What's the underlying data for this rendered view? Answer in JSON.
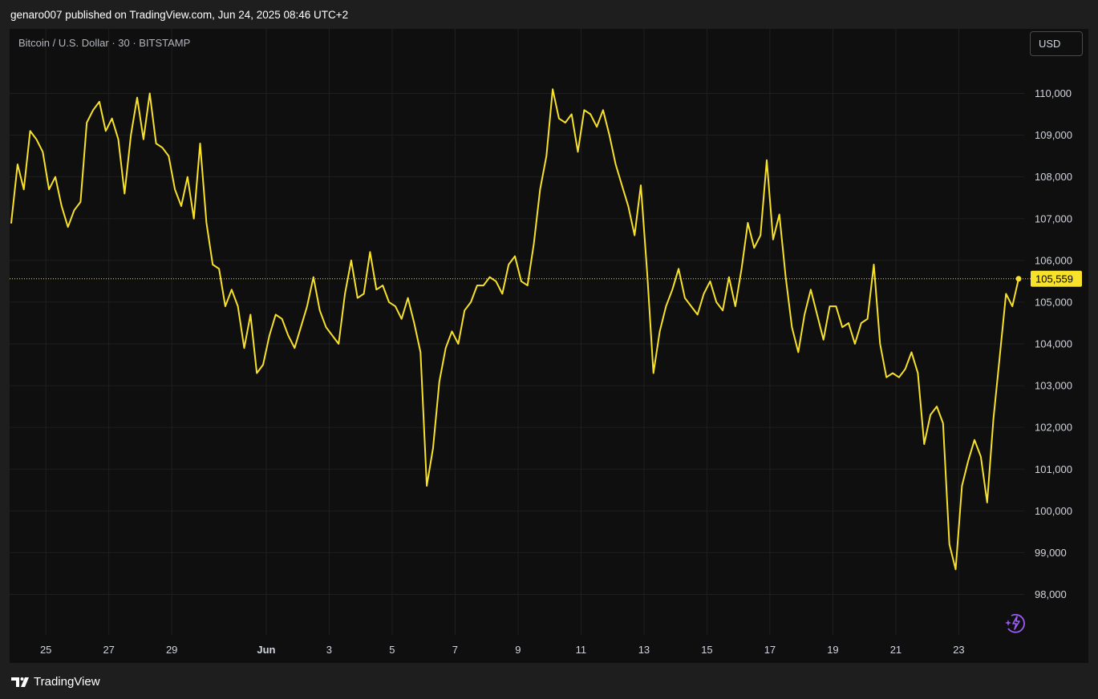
{
  "header": {
    "published_text": "genaro007 published on TradingView.com, Jun 24, 2025 08:46 UTC+2"
  },
  "chart_header": {
    "symbol_label": "Bitcoin / U.S. Dollar · 30 · BITSTAMP",
    "currency_button": "USD"
  },
  "footer": {
    "brand": "TradingView"
  },
  "icons": [
    "tradingview-logo-icon",
    "lightning-icon"
  ],
  "colors": {
    "line": "#f7e12a",
    "background": "#0f0f0f",
    "grid": "#1f1f1f",
    "price_label_bg": "#f7e12a",
    "bolt": "#9b5cf6"
  },
  "chart_data": {
    "type": "line",
    "title": "Bitcoin / U.S. Dollar · 30 · BITSTAMP",
    "xlabel": "",
    "ylabel": "",
    "ylim": [
      97200,
      111200
    ],
    "grid": true,
    "legend": "none",
    "y_ticks": [
      98000,
      99000,
      100000,
      101000,
      102000,
      103000,
      104000,
      105000,
      106000,
      107000,
      108000,
      109000,
      110000
    ],
    "y_tick_labels": [
      "98,000",
      "99,000",
      "100,000",
      "101,000",
      "102,000",
      "103,000",
      "104,000",
      "105,000",
      "106,000",
      "107,000",
      "108,000",
      "109,000",
      "110,000"
    ],
    "x_ticks": [
      {
        "label": "25",
        "t": 25
      },
      {
        "label": "27",
        "t": 27
      },
      {
        "label": "29",
        "t": 29
      },
      {
        "label": "Jun",
        "t": 32
      },
      {
        "label": "3",
        "t": 34
      },
      {
        "label": "5",
        "t": 36
      },
      {
        "label": "7",
        "t": 38
      },
      {
        "label": "9",
        "t": 40
      },
      {
        "label": "11",
        "t": 42
      },
      {
        "label": "13",
        "t": 44
      },
      {
        "label": "15",
        "t": 46
      },
      {
        "label": "17",
        "t": 48
      },
      {
        "label": "19",
        "t": 50
      },
      {
        "label": "21",
        "t": 52
      },
      {
        "label": "23",
        "t": 54
      }
    ],
    "last_price": 105559,
    "last_price_label": "105,559",
    "series": [
      {
        "points": [
          [
            23.9,
            106900
          ],
          [
            24.1,
            108300
          ],
          [
            24.3,
            107700
          ],
          [
            24.5,
            109100
          ],
          [
            24.7,
            108900
          ],
          [
            24.9,
            108600
          ],
          [
            25.1,
            107700
          ],
          [
            25.3,
            108000
          ],
          [
            25.5,
            107300
          ],
          [
            25.7,
            106800
          ],
          [
            25.9,
            107200
          ],
          [
            26.1,
            107400
          ],
          [
            26.3,
            109300
          ],
          [
            26.5,
            109600
          ],
          [
            26.7,
            109800
          ],
          [
            26.9,
            109100
          ],
          [
            27.1,
            109400
          ],
          [
            27.3,
            108900
          ],
          [
            27.5,
            107600
          ],
          [
            27.7,
            109000
          ],
          [
            27.9,
            109900
          ],
          [
            28.1,
            108900
          ],
          [
            28.3,
            110000
          ],
          [
            28.5,
            108800
          ],
          [
            28.7,
            108700
          ],
          [
            28.9,
            108500
          ],
          [
            29.1,
            107700
          ],
          [
            29.3,
            107300
          ],
          [
            29.5,
            108000
          ],
          [
            29.7,
            107000
          ],
          [
            29.9,
            108800
          ],
          [
            30.1,
            106900
          ],
          [
            30.3,
            105900
          ],
          [
            30.5,
            105800
          ],
          [
            30.7,
            104900
          ],
          [
            30.9,
            105300
          ],
          [
            31.1,
            104900
          ],
          [
            31.3,
            103900
          ],
          [
            31.5,
            104700
          ],
          [
            31.7,
            103300
          ],
          [
            31.9,
            103500
          ],
          [
            32.1,
            104200
          ],
          [
            32.3,
            104700
          ],
          [
            32.5,
            104600
          ],
          [
            32.7,
            104200
          ],
          [
            32.9,
            103900
          ],
          [
            33.1,
            104400
          ],
          [
            33.3,
            104900
          ],
          [
            33.5,
            105600
          ],
          [
            33.7,
            104800
          ],
          [
            33.9,
            104400
          ],
          [
            34.1,
            104200
          ],
          [
            34.3,
            104000
          ],
          [
            34.5,
            105200
          ],
          [
            34.7,
            106000
          ],
          [
            34.9,
            105100
          ],
          [
            35.1,
            105200
          ],
          [
            35.3,
            106200
          ],
          [
            35.5,
            105300
          ],
          [
            35.7,
            105400
          ],
          [
            35.9,
            105000
          ],
          [
            36.1,
            104900
          ],
          [
            36.3,
            104600
          ],
          [
            36.5,
            105100
          ],
          [
            36.7,
            104500
          ],
          [
            36.9,
            103800
          ],
          [
            37.1,
            100600
          ],
          [
            37.3,
            101500
          ],
          [
            37.5,
            103100
          ],
          [
            37.7,
            103900
          ],
          [
            37.9,
            104300
          ],
          [
            38.1,
            104000
          ],
          [
            38.3,
            104800
          ],
          [
            38.5,
            105000
          ],
          [
            38.7,
            105400
          ],
          [
            38.9,
            105400
          ],
          [
            39.1,
            105600
          ],
          [
            39.3,
            105500
          ],
          [
            39.5,
            105200
          ],
          [
            39.7,
            105900
          ],
          [
            39.9,
            106100
          ],
          [
            40.1,
            105500
          ],
          [
            40.3,
            105400
          ],
          [
            40.5,
            106400
          ],
          [
            40.7,
            107700
          ],
          [
            40.9,
            108500
          ],
          [
            41.1,
            110100
          ],
          [
            41.3,
            109400
          ],
          [
            41.5,
            109300
          ],
          [
            41.7,
            109500
          ],
          [
            41.9,
            108600
          ],
          [
            42.1,
            109600
          ],
          [
            42.3,
            109500
          ],
          [
            42.5,
            109200
          ],
          [
            42.7,
            109600
          ],
          [
            42.9,
            109000
          ],
          [
            43.1,
            108300
          ],
          [
            43.3,
            107800
          ],
          [
            43.5,
            107300
          ],
          [
            43.7,
            106600
          ],
          [
            43.9,
            107800
          ],
          [
            44.1,
            105700
          ],
          [
            44.3,
            103300
          ],
          [
            44.5,
            104300
          ],
          [
            44.7,
            104900
          ],
          [
            44.9,
            105300
          ],
          [
            45.1,
            105800
          ],
          [
            45.3,
            105100
          ],
          [
            45.5,
            104900
          ],
          [
            45.7,
            104700
          ],
          [
            45.9,
            105200
          ],
          [
            46.1,
            105500
          ],
          [
            46.3,
            105000
          ],
          [
            46.5,
            104800
          ],
          [
            46.7,
            105600
          ],
          [
            46.9,
            104900
          ],
          [
            47.1,
            105800
          ],
          [
            47.3,
            106900
          ],
          [
            47.5,
            106300
          ],
          [
            47.7,
            106600
          ],
          [
            47.9,
            108400
          ],
          [
            48.1,
            106500
          ],
          [
            48.3,
            107100
          ],
          [
            48.5,
            105600
          ],
          [
            48.7,
            104400
          ],
          [
            48.9,
            103800
          ],
          [
            49.1,
            104700
          ],
          [
            49.3,
            105300
          ],
          [
            49.5,
            104700
          ],
          [
            49.7,
            104100
          ],
          [
            49.9,
            104900
          ],
          [
            50.1,
            104900
          ],
          [
            50.3,
            104400
          ],
          [
            50.5,
            104500
          ],
          [
            50.7,
            104000
          ],
          [
            50.9,
            104500
          ],
          [
            51.1,
            104600
          ],
          [
            51.3,
            105900
          ],
          [
            51.5,
            104000
          ],
          [
            51.7,
            103200
          ],
          [
            51.9,
            103300
          ],
          [
            52.1,
            103200
          ],
          [
            52.3,
            103400
          ],
          [
            52.5,
            103800
          ],
          [
            52.7,
            103300
          ],
          [
            52.9,
            101600
          ],
          [
            53.1,
            102300
          ],
          [
            53.3,
            102500
          ],
          [
            53.5,
            102100
          ],
          [
            53.7,
            99200
          ],
          [
            53.9,
            98600
          ],
          [
            54.1,
            100600
          ],
          [
            54.3,
            101200
          ],
          [
            54.5,
            101700
          ],
          [
            54.7,
            101300
          ],
          [
            54.9,
            100200
          ],
          [
            55.1,
            102200
          ],
          [
            55.3,
            103700
          ],
          [
            55.5,
            105200
          ],
          [
            55.7,
            104900
          ],
          [
            55.9,
            105559
          ]
        ]
      }
    ]
  }
}
